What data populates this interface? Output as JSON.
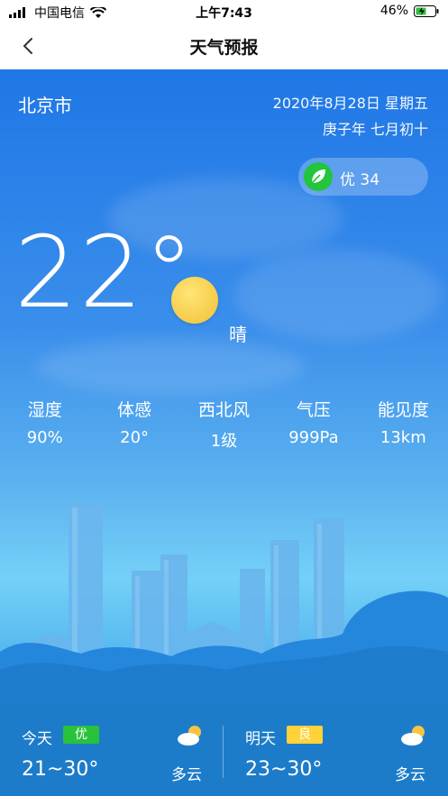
{
  "status_bar": {
    "carrier": "中国电信",
    "time": "上午7:43",
    "battery": "46%"
  },
  "nav": {
    "title": "天气预报"
  },
  "location": {
    "city": "北京市"
  },
  "date": {
    "gregorian": "2020年8月28日  星期五",
    "lunar": "庚子年  七月初十"
  },
  "aqi": {
    "label": "优 34"
  },
  "current": {
    "temperature": "22°",
    "condition": "晴"
  },
  "stats": [
    {
      "label": "湿度",
      "value": "90%"
    },
    {
      "label": "体感",
      "value": "20°"
    },
    {
      "label": "西北风",
      "value": "1级"
    },
    {
      "label": "气压",
      "value": "999Pa"
    },
    {
      "label": "能见度",
      "value": "13km"
    }
  ],
  "forecast": [
    {
      "day": "今天",
      "quality": "优",
      "quality_color": "#29c23b",
      "quality_text_color": "#ffffff",
      "temp": "21~30°",
      "condition": "多云"
    },
    {
      "day": "明天",
      "quality": "良",
      "quality_color": "#ffd23a",
      "quality_text_color": "#ffffff",
      "temp": "23~30°",
      "condition": "多云"
    }
  ],
  "colors": {
    "accent": "#1f77e6",
    "forecast_bg": "#1d7cc9",
    "aqi_leaf": "#22c53c"
  }
}
